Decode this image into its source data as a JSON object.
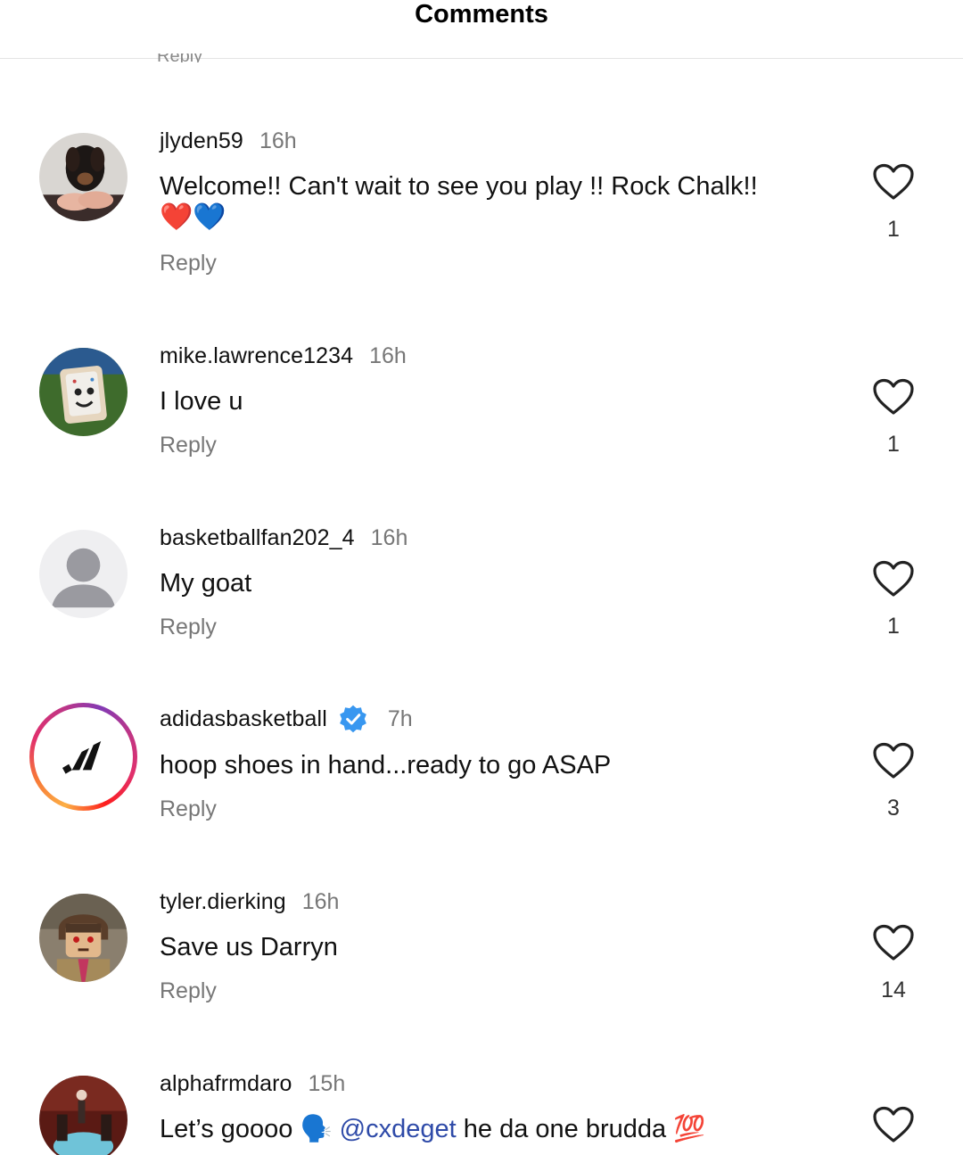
{
  "header": {
    "title": "Comments"
  },
  "clipped_reply_label": "Reply",
  "comments": [
    {
      "username": "jlyden59",
      "time": "16h",
      "text": "Welcome!! Can't wait to see you play !! Rock Chalk!!",
      "emoji": "❤️💙",
      "reply_label": "Reply",
      "likes": "1",
      "avatar": "dachshund-photo"
    },
    {
      "username": "mike.lawrence1234",
      "time": "16h",
      "text": "I love u",
      "reply_label": "Reply",
      "likes": "1",
      "avatar": "pop-tart-photo"
    },
    {
      "username": "basketballfan202_4",
      "time": "16h",
      "text": "My goat",
      "reply_label": "Reply",
      "likes": "1",
      "avatar": "default-user"
    },
    {
      "username": "adidasbasketball",
      "verified": true,
      "time": "7h",
      "text": "hoop shoes in hand...ready to go ASAP",
      "reply_label": "Reply",
      "likes": "3",
      "avatar": "adidas-logo"
    },
    {
      "username": "tyler.dierking",
      "time": "16h",
      "text": "Save us Darryn",
      "reply_label": "Reply",
      "likes": "14",
      "avatar": "lego-figure-photo"
    },
    {
      "username": "alphafrmdaro",
      "time": "15h",
      "text_before": "Let’s goooo 🗣️",
      "mention": "@cxdeget",
      "text_after": "he da one brudda 💯",
      "avatar": "room-photo"
    }
  ],
  "colors": {
    "verified": "#3897f0",
    "mention": "#2e4aa8",
    "muted_text": "#777777"
  }
}
